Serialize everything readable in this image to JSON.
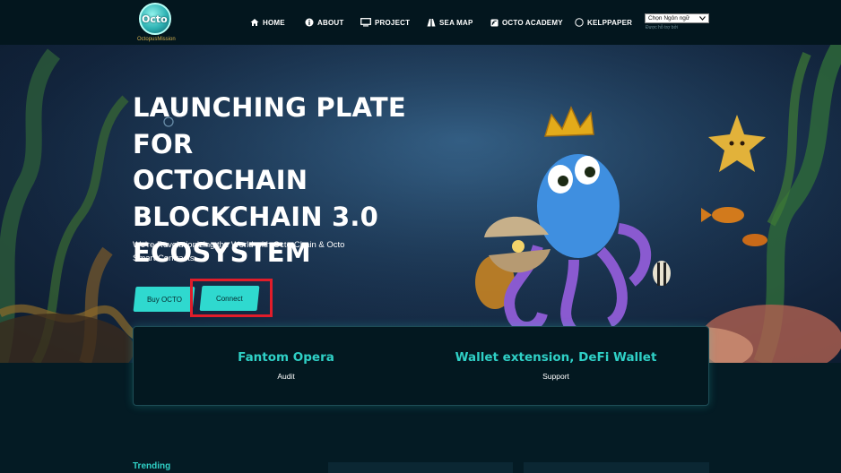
{
  "nav": {
    "logo_text": "Octo",
    "logo_sub": "OctopusMission",
    "items": [
      {
        "label": "HOME",
        "icon": "home-icon"
      },
      {
        "label": "ABOUT",
        "icon": "info-icon"
      },
      {
        "label": "PROJECT",
        "icon": "monitor-icon"
      },
      {
        "label": "SEA MAP",
        "icon": "map-icon"
      },
      {
        "label": "OCTO ACADEMY",
        "icon": "academy-icon"
      },
      {
        "label": "KELPPAPER",
        "icon": "circle-icon"
      }
    ],
    "language_select": "Chọn Ngôn ngữ",
    "language_note": "Được hỗ trợ bởi"
  },
  "hero": {
    "title_lines": [
      "LAUNCHING PLATE FOR",
      "OCTOCHAIN",
      "BLOCKCHAIN 3.0",
      "ECOSYSTEM"
    ],
    "subtitle": "We're Revolutionizing the World with Octo-Chain & Octo Smart Contracts",
    "buy_label": "Buy OCTO",
    "connect_label": "Connect"
  },
  "stats": [
    {
      "title": "Fantom Opera",
      "label": "Audit"
    },
    {
      "title": "Wallet extension, DeFi Wallet",
      "label": "Support"
    }
  ],
  "trending_label": "Trending",
  "colors": {
    "accent": "#2fd9cf",
    "background": "#041b24",
    "highlight": "#e11d2a"
  }
}
